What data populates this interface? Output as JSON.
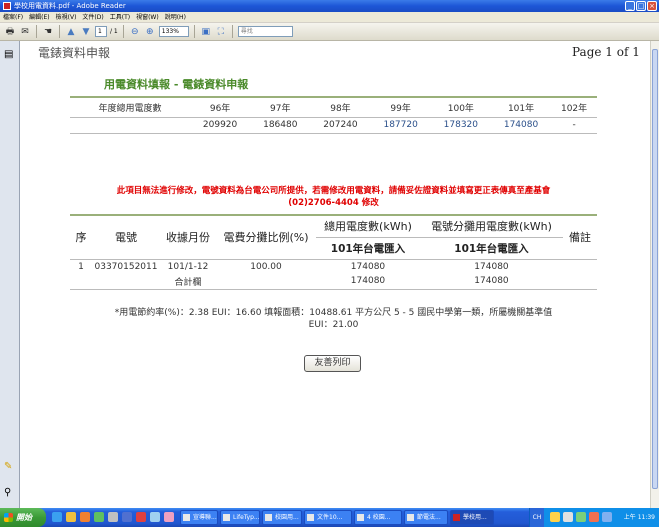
{
  "window": {
    "title": "學校用電資料.pdf - Adobe Reader",
    "controls": [
      "_",
      "□",
      "×"
    ]
  },
  "menu": [
    "檔案(F)",
    "編輯(E)",
    "檢視(V)",
    "文件(D)",
    "工具(T)",
    "視窗(W)",
    "說明(H)"
  ],
  "toolbar": {
    "page_current": "1",
    "page_total": "/ 1",
    "zoom": "133%",
    "search_placeholder": "尋找"
  },
  "page": {
    "header_left": "電錶資料申報",
    "header_right": "Page 1 of 1",
    "title": "用電資料填報 - 電錶資料申報"
  },
  "year_table": {
    "headers": [
      "年度總用電度數",
      "96年",
      "97年",
      "98年",
      "99年",
      "100年",
      "101年",
      "102年"
    ],
    "values": [
      "",
      "209920",
      "186480",
      "207240",
      "187720",
      "178320",
      "174080",
      "-"
    ]
  },
  "notice": {
    "line1": "此項目無法進行修改，電號資料為台電公司所提供，若需修改用電資料，請備妥佐證資料並填寫更正表傳真至產基會",
    "line2": "(02)2706-4404 修改"
  },
  "meter_table": {
    "col_seq": "序",
    "col_meter": "電號",
    "col_month": "收據月份",
    "col_ratio": "電費分攤比例(%)",
    "col_total": "總用電度數(kWh)",
    "col_alloc": "電號分攤用電度數(kWh)",
    "col_note": "備註",
    "sub_total": "101年台電匯入",
    "sub_alloc": "101年台電匯入",
    "row": {
      "seq": "1",
      "meter": "03370152011",
      "month": "101/1-12",
      "ratio": "100.00",
      "total": "174080",
      "alloc": "174080"
    },
    "sum_row": {
      "label": "合計欄",
      "total": "174080",
      "alloc": "174080"
    }
  },
  "summary": {
    "line1": "*用電節約率(%)：2.38    EUI：16.60    填報面積：10488.61 平方公尺    5 - 5 國民中學第一類，所屬機關基準值",
    "line2": "EUI：21.00"
  },
  "print_button": "友善列印",
  "taskbar": {
    "start": "開始",
    "tasks": [
      "宣導聯...",
      "LifeTyp...",
      "校園用...",
      "文件10...",
      "4 校園...",
      "節電法...",
      "學校用..."
    ],
    "lang": "CH",
    "clock": "上午 11:39"
  }
}
